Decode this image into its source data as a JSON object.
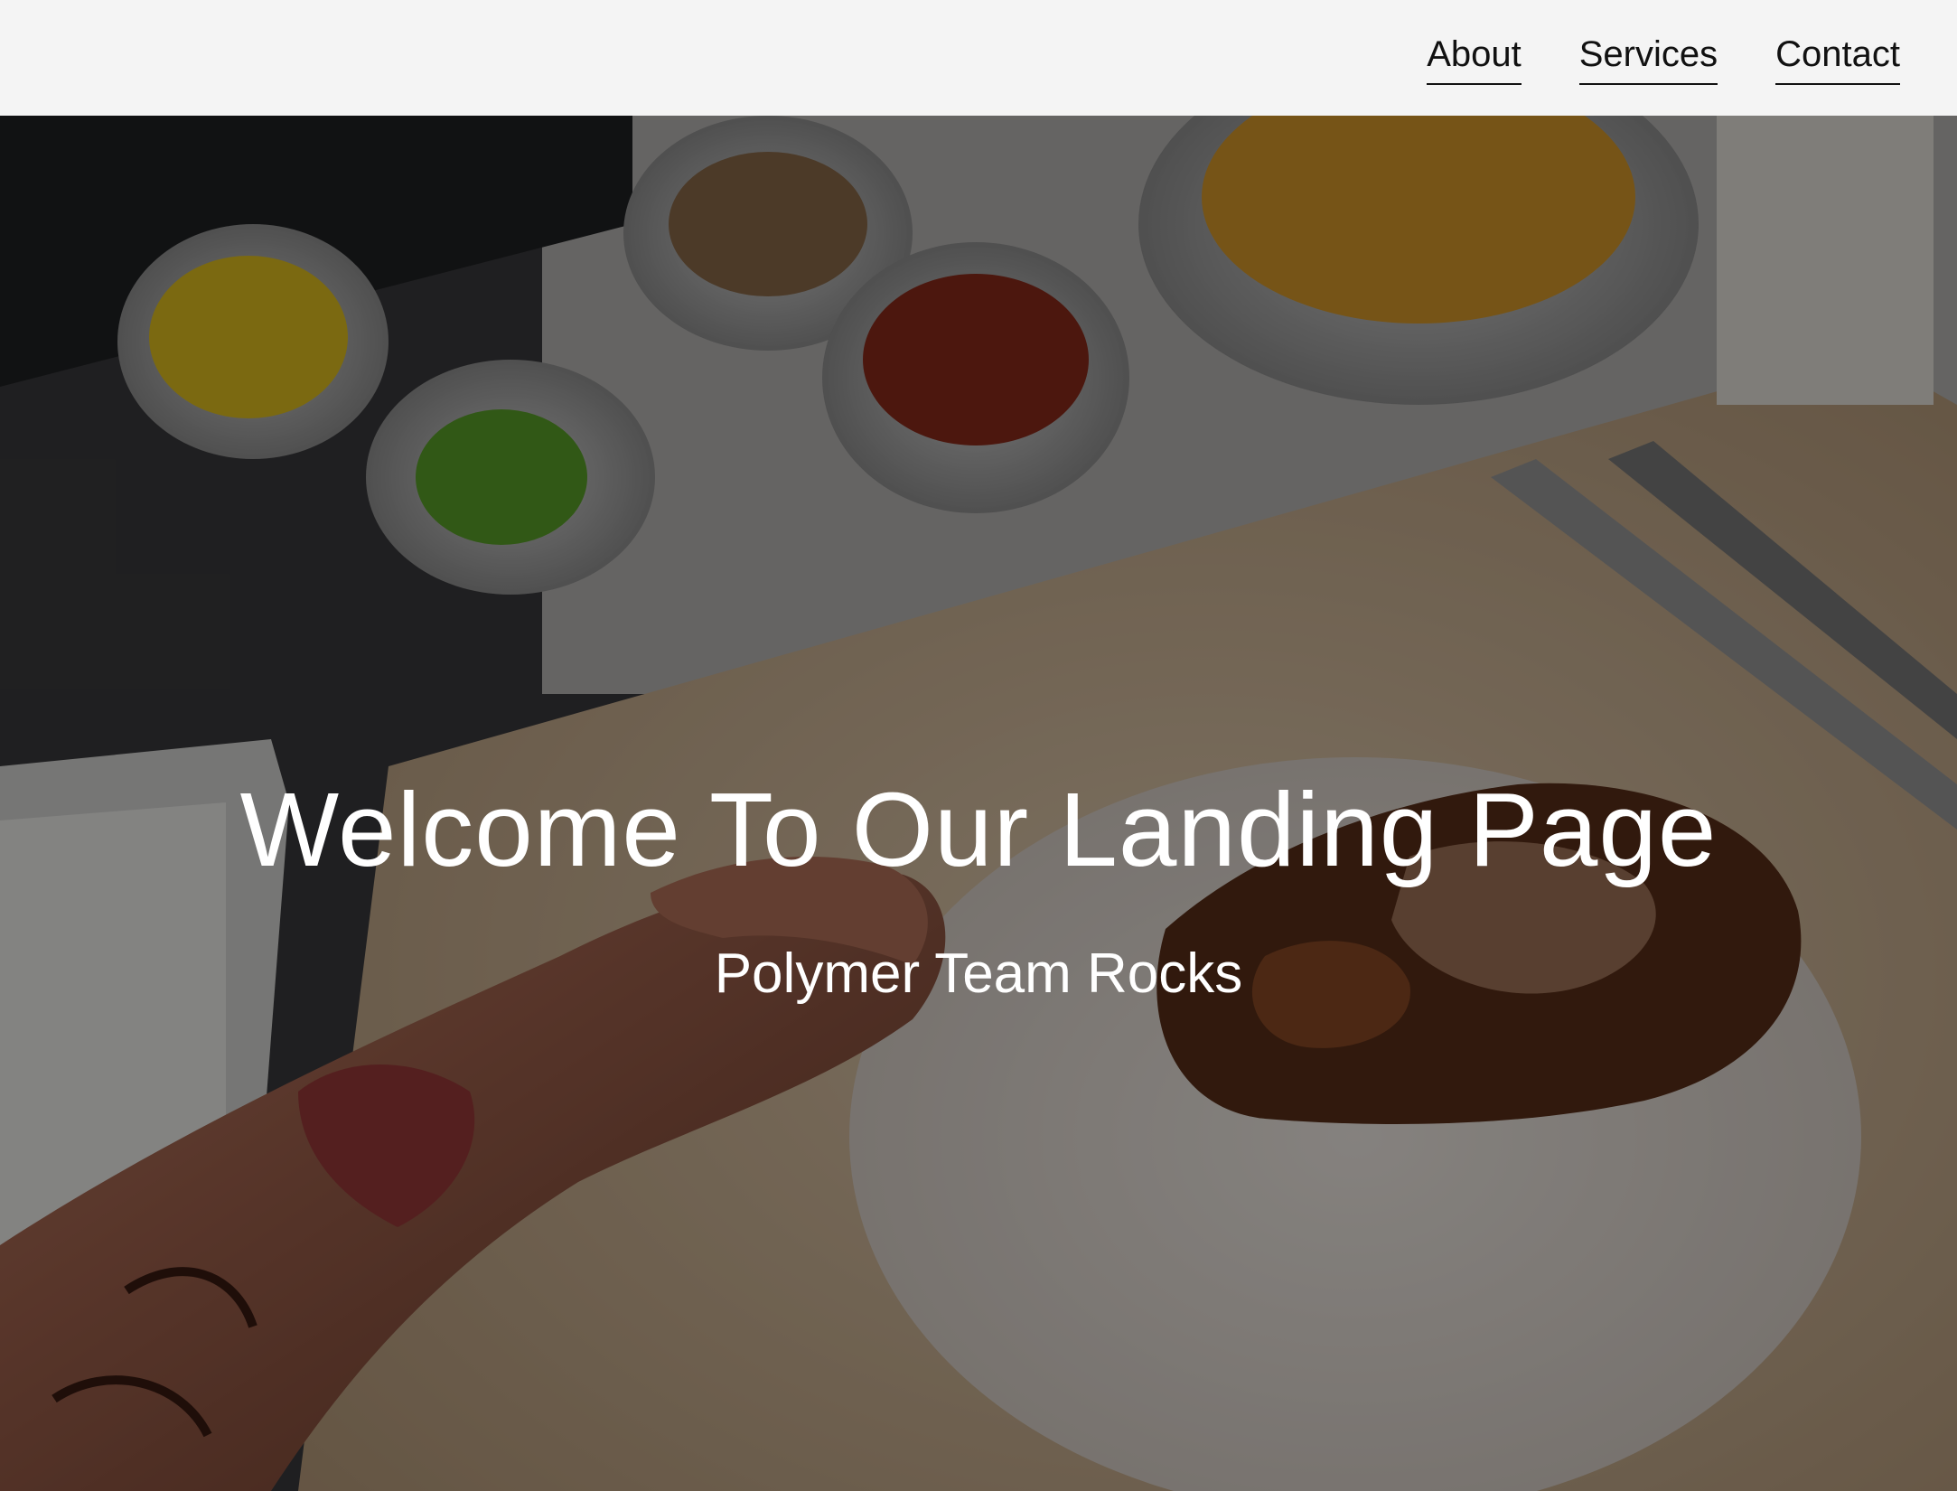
{
  "nav": {
    "items": [
      {
        "label": "About"
      },
      {
        "label": "Services"
      },
      {
        "label": "Contact"
      }
    ]
  },
  "hero": {
    "title": "Welcome To Our Landing Page",
    "subtitle": "Polymer Team Rocks",
    "background_image": "food-prep-photo",
    "overlay_color": "#000000"
  },
  "colors": {
    "header_bg": "#f4f4f4",
    "nav_text": "#111111",
    "hero_text": "#ffffff"
  }
}
